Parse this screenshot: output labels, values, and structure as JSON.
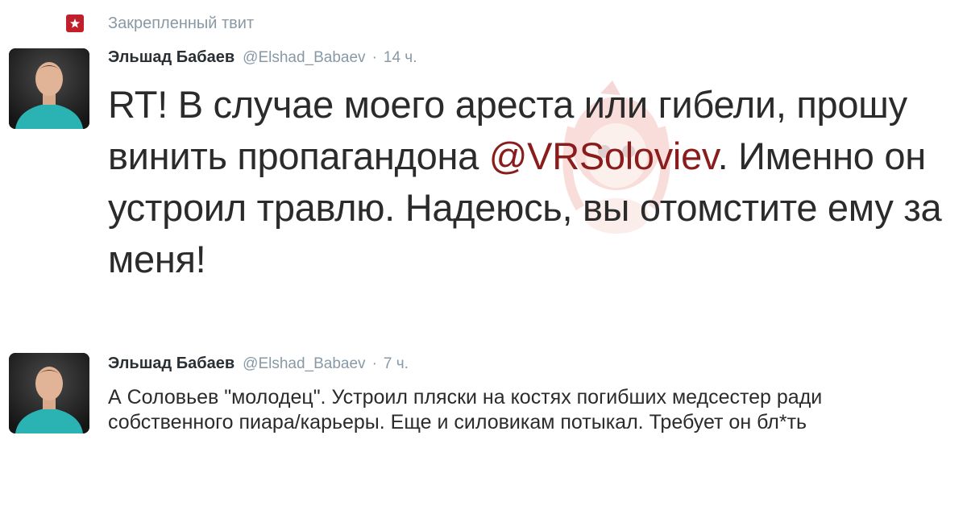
{
  "pinned": {
    "label": "Закрепленный твит",
    "icon": "pin-icon"
  },
  "tweets": [
    {
      "name": "Эльшад Бабаев",
      "handle": "@Elshad_Babaev",
      "separator": "·",
      "time": "14 ч.",
      "text_before_mention": "RT! В случае моего ареста или гибели, прошу винить пропагандона ",
      "mention": "@VRSoloviev",
      "text_after_mention": ". Именно он устроил травлю. Надеюсь, вы отомстите ему за меня!"
    },
    {
      "name": "Эльшад Бабаев",
      "handle": "@Elshad_Babaev",
      "separator": "·",
      "time": "7 ч.",
      "text": "А Соловьев \"молодец\". Устроил пляски на костях погибших медсестер ради собственного пиара/карьеры. Еще и силовикам потыкал. Требует он бл*ть"
    }
  ],
  "colors": {
    "mention": "#8b1c1c",
    "meta": "#8899a6",
    "pin_badge": "#c0202a"
  }
}
